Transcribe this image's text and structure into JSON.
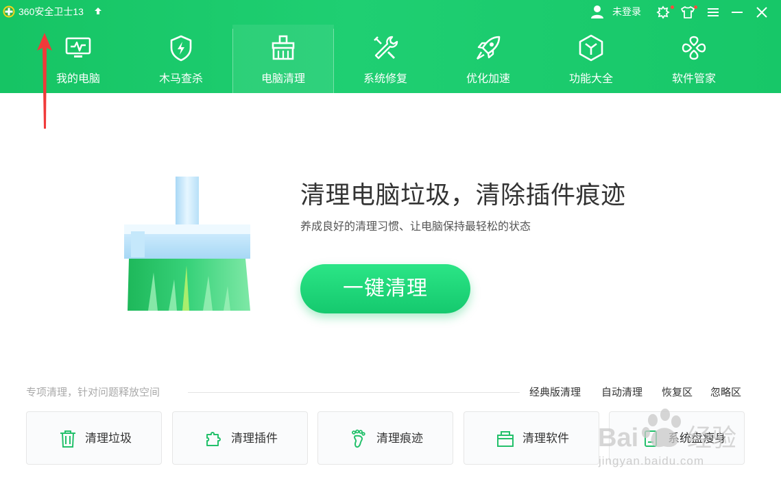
{
  "app": {
    "title": "360安全卫士13",
    "login_text": "未登录"
  },
  "colors": {
    "brand": "#1dcc6e",
    "accent_red": "#ff4a3b",
    "annotation": "#f03a3a"
  },
  "titlebar_icons": [
    "user-icon",
    "skin-cloud-icon",
    "shirt-icon",
    "menu-icon",
    "minimize-icon",
    "close-icon"
  ],
  "nav": [
    {
      "label": "我的电脑",
      "icon": "monitor-icon",
      "active": false
    },
    {
      "label": "木马查杀",
      "icon": "shield-icon",
      "active": false
    },
    {
      "label": "电脑清理",
      "icon": "broom-icon",
      "active": true
    },
    {
      "label": "系统修复",
      "icon": "wrench-icon",
      "active": false
    },
    {
      "label": "优化加速",
      "icon": "rocket-icon",
      "active": false
    },
    {
      "label": "功能大全",
      "icon": "cube-icon",
      "active": false
    },
    {
      "label": "软件管家",
      "icon": "apps-icon",
      "active": false
    }
  ],
  "hero": {
    "title": "清理电脑垃圾，清除插件痕迹",
    "subtitle": "养成良好的清理习惯、让电脑保持最轻松的状态",
    "button": "一键清理"
  },
  "special": {
    "title": "专项清理，针对问题释放空间",
    "links": [
      "经典版清理",
      "自动清理",
      "恢复区",
      "忽略区"
    ],
    "cards": [
      {
        "label": "清理垃圾",
        "icon": "trash-icon"
      },
      {
        "label": "清理插件",
        "icon": "puzzle-icon"
      },
      {
        "label": "清理痕迹",
        "icon": "footprint-icon"
      },
      {
        "label": "清理软件",
        "icon": "package-icon"
      },
      {
        "label": "系统盘瘦身",
        "icon": "disk-icon"
      }
    ]
  },
  "watermark": {
    "text": "jingyan.baidu.com"
  }
}
